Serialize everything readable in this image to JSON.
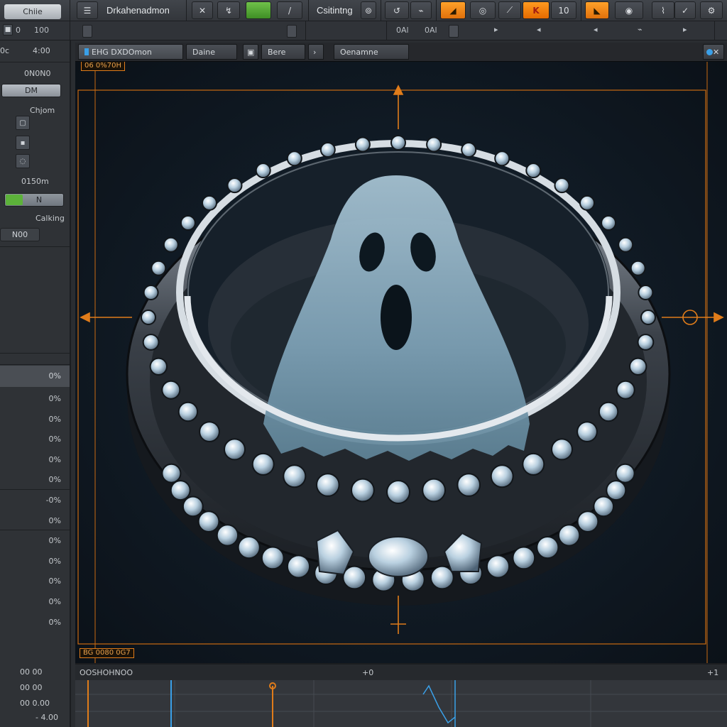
{
  "toolbar": {
    "app_name": "Drkahenadmon",
    "file_pill": "Chiie",
    "mode_label": "Csitintng",
    "btn_frame": "10",
    "sub_left_a": "0",
    "sub_left_b": "100",
    "sub_items": [
      "0Al",
      "0Al"
    ]
  },
  "left_panel": {
    "coord_a": "0c",
    "coord_b": "4:00",
    "header": "0N0N0",
    "top_button": "DM",
    "group_label": "Chjom",
    "value_label": "0150m",
    "toggle_label": "N",
    "section_label": "Calking",
    "small_button": "N00",
    "list_selected": "0%",
    "list_items": [
      "0%",
      "0%",
      "0%",
      "0%",
      "0%",
      "-0%",
      "0%",
      "0%",
      "0%",
      "0%",
      "0%",
      "0%"
    ]
  },
  "tabs": [
    {
      "label": "EHG DXDOmon"
    },
    {
      "label": "Daine"
    },
    {
      "label": "Bere"
    },
    {
      "label": "Oenamne"
    }
  ],
  "viewport": {
    "top_label": "06 0%70H",
    "bottom_label": "BG 0080 0G7"
  },
  "timeline": {
    "title": "OOSHOHNOO",
    "marker_mid": "+0",
    "marker_right": "+1",
    "rows": [
      "00  00",
      "00  00",
      "00  0.00",
      "- 4.00"
    ]
  },
  "colors": {
    "accent": "#e07c1a",
    "green": "#5cb23a",
    "playhead": "#3aa0e8"
  }
}
